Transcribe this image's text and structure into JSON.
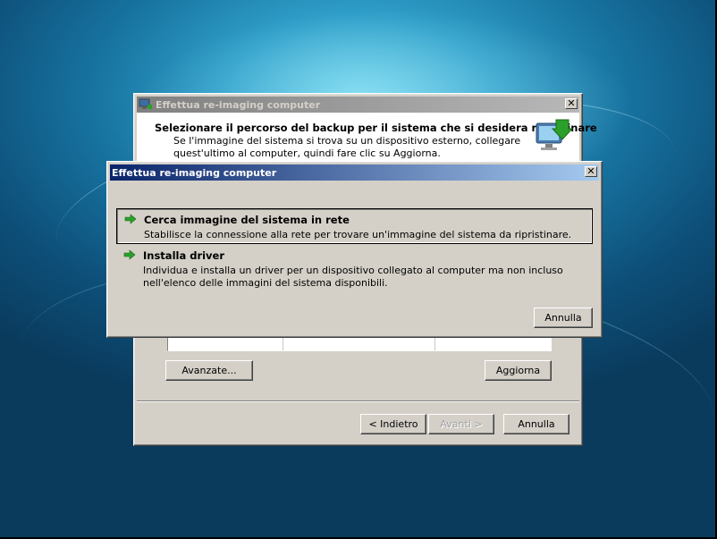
{
  "back_window": {
    "title": "Effettua re-imaging computer",
    "header_title": "Selezionare il percorso del backup per il sistema che si desidera ripristinare",
    "header_description": "Se l'immagine del sistema si trova su un dispositivo esterno, collegare quest'ultimo al computer, quindi fare clic su Aggiorna.",
    "advanced_label": "Avanzate...",
    "refresh_label": "Aggiorna",
    "back_label": "< Indietro",
    "next_label": "Avanti >",
    "cancel_label": "Annulla",
    "close_glyph": "✕"
  },
  "front_dialog": {
    "title": "Effettua re-imaging computer",
    "close_glyph": "✕",
    "options": [
      {
        "title": "Cerca immagine del sistema in rete",
        "description": "Stabilisce la connessione alla rete per trovare un'immagine del sistema da ripristinare.",
        "selected": true,
        "icon": "green-arrow-icon"
      },
      {
        "title": "Installa driver",
        "description": "Individua e installa un driver per un dispositivo collegato al computer ma non incluso nell'elenco delle immagini del sistema disponibili.",
        "selected": false,
        "icon": "green-arrow-icon"
      }
    ],
    "cancel_label": "Annulla"
  },
  "colors": {
    "arrow_green": "#2aa02a",
    "active_title_start": "#0a246a",
    "active_title_end": "#a6caf0"
  }
}
